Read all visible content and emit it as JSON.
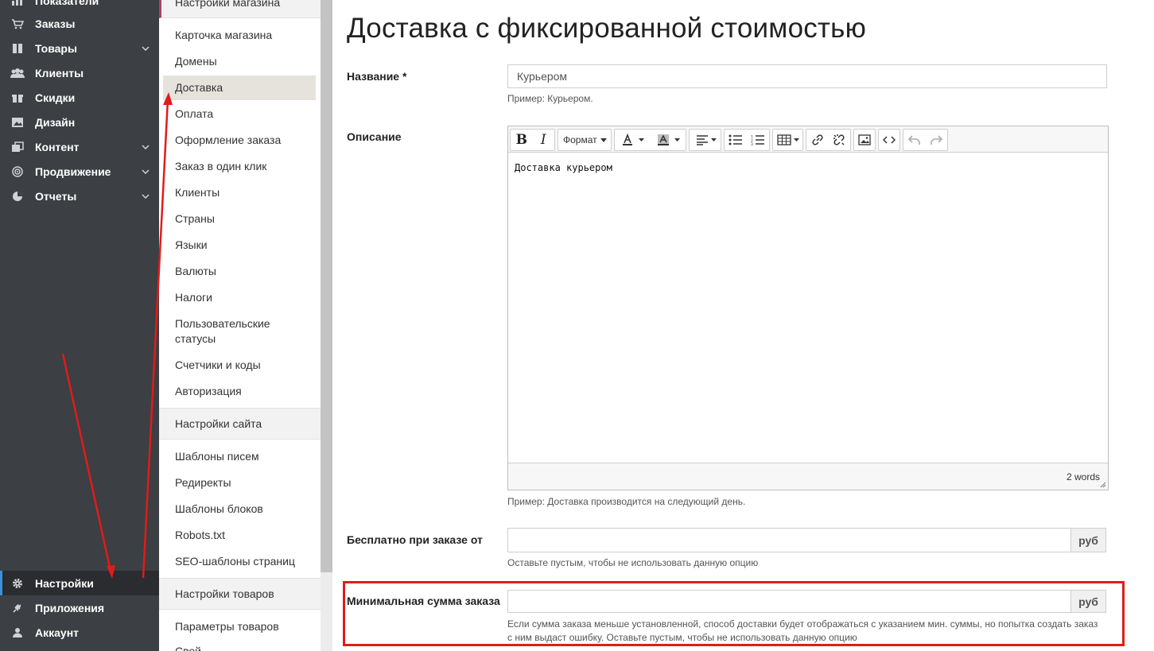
{
  "sidebar": {
    "items": [
      {
        "label": "Показатели",
        "icon": "chart-icon",
        "chevron": false
      },
      {
        "label": "Заказы",
        "icon": "cart-icon",
        "chevron": false
      },
      {
        "label": "Товары",
        "icon": "book-icon",
        "chevron": true
      },
      {
        "label": "Клиенты",
        "icon": "users-icon",
        "chevron": false
      },
      {
        "label": "Скидки",
        "icon": "gift-icon",
        "chevron": false
      },
      {
        "label": "Дизайн",
        "icon": "image-icon",
        "chevron": false
      },
      {
        "label": "Контент",
        "icon": "content-icon",
        "chevron": true
      },
      {
        "label": "Продвижение",
        "icon": "target-icon",
        "chevron": true
      },
      {
        "label": "Отчеты",
        "icon": "pie-icon",
        "chevron": true
      },
      {
        "label": "Настройки",
        "icon": "gear-icon",
        "chevron": false,
        "active": true
      },
      {
        "label": "Приложения",
        "icon": "plug-icon",
        "chevron": false
      },
      {
        "label": "Аккаунт",
        "icon": "user-icon",
        "chevron": false
      }
    ]
  },
  "submenu": {
    "store_header": "Настройки магазина",
    "store_items": [
      "Карточка магазина",
      "Домены",
      "Доставка",
      "Оплата",
      "Оформление заказа",
      "Заказ в один клик",
      "Клиенты",
      "Страны",
      "Языки",
      "Валюты",
      "Налоги",
      "Пользовательские статусы",
      "Счетчики и коды",
      "Авторизация"
    ],
    "site_header": "Настройки сайта",
    "site_items": [
      "Шаблоны писем",
      "Редиректы",
      "Шаблоны блоков",
      "Robots.txt",
      "SEO-шаблоны страниц"
    ],
    "goods_header": "Настройки товаров",
    "goods_items": [
      "Параметры товаров",
      "Свой..."
    ]
  },
  "main": {
    "title": "Доставка с фиксированной стоимостью",
    "name_label": "Название *",
    "name_value": "Курьером",
    "name_hint": "Пример: Курьером.",
    "desc_label": "Описание",
    "toolbar_format": "Формат",
    "editor_content": "Доставка курьером",
    "words": "2 words",
    "desc_hint": "Пример: Доставка производится на следующий день.",
    "free_label": "Бесплатно при заказе от",
    "free_value": "",
    "free_addon": "руб",
    "free_hint": "Оставьте пустым, чтобы не использовать данную опцию",
    "min_label": "Минимальная сумма заказа",
    "min_value": "",
    "min_addon": "руб",
    "min_hint_1": "Если сумма заказа меньше установленной, способ доставки будет отображаться с указанием мин. суммы, но попытка создать заказ",
    "min_hint_2": "с ним выдаст ошибку. Оставьте пустым, чтобы не использовать данную опцию"
  },
  "colors": {
    "sidebar_bg": "#3c3f43",
    "active_accent": "#3d8fe0",
    "annotation_red": "#e11b1b",
    "submenu_active_bg": "#e6e3dc"
  }
}
